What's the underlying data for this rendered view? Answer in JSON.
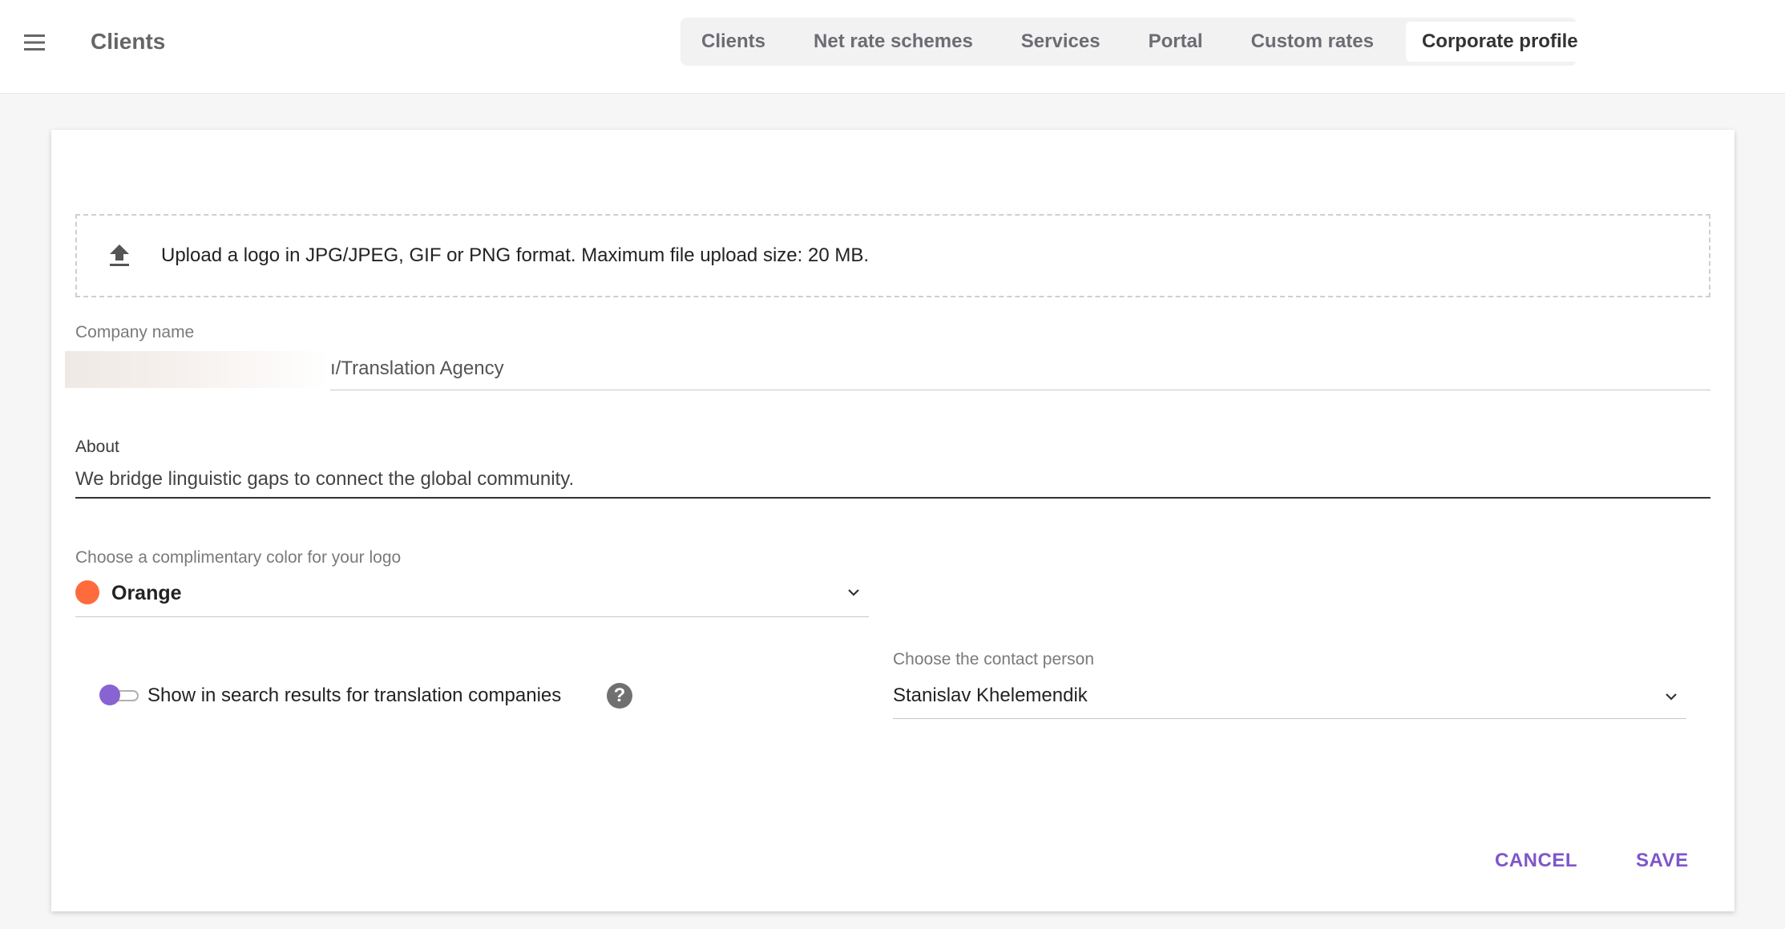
{
  "header": {
    "app_title": "Clients",
    "menu_icon": "hamburger-menu-icon",
    "tabs": [
      {
        "label": "Clients",
        "active": false
      },
      {
        "label": "Net rate schemes",
        "active": false
      },
      {
        "label": "Services",
        "active": false
      },
      {
        "label": "Portal",
        "active": false
      },
      {
        "label": "Custom rates",
        "active": false
      },
      {
        "label": "Corporate profile",
        "active": true
      }
    ]
  },
  "form": {
    "upload": {
      "icon": "upload-icon",
      "text": "Upload a logo in JPG/JPEG, GIF or PNG format. Maximum file upload size: 20 MB."
    },
    "company_name": {
      "label": "Company name",
      "value": "ı/Translation Agency"
    },
    "about": {
      "label": "About",
      "value": "We bridge linguistic gaps to connect the global community."
    },
    "logo_color": {
      "label": "Choose a complimentary color for your logo",
      "value": "Orange",
      "swatch": "#ff6b3d",
      "icon": "chevron-down-icon"
    },
    "search_toggle": {
      "label": "Show in search results for translation companies",
      "enabled": false,
      "accent": "#8a63d2",
      "help_icon": "question-mark-icon",
      "help_glyph": "?"
    },
    "contact_person": {
      "label": "Choose the contact person",
      "value": "Stanislav Khelemendik",
      "icon": "chevron-down-icon"
    }
  },
  "actions": {
    "cancel_label": "CANCEL",
    "save_label": "SAVE",
    "accent": "#7e56c8"
  }
}
